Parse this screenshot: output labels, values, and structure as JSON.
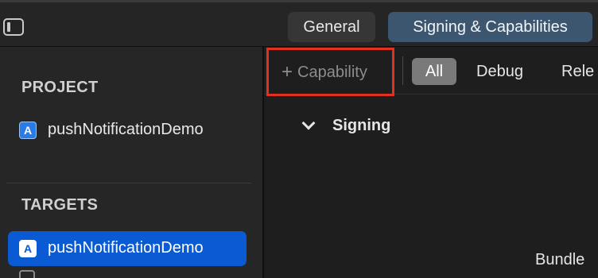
{
  "toolbar": {
    "tabs": [
      {
        "label": "General",
        "selected": false
      },
      {
        "label": "Signing & Capabilities",
        "selected": true
      }
    ]
  },
  "sidebar": {
    "project_header": "PROJECT",
    "project_item": "pushNotificationDemo",
    "targets_header": "TARGETS",
    "target_item": "pushNotificationDemo",
    "icon_glyph": "A"
  },
  "main": {
    "capability_plus": "+",
    "capability_label": "Capability",
    "filters": [
      {
        "label": "All",
        "selected": true
      },
      {
        "label": "Debug",
        "selected": false
      },
      {
        "label": "Rele",
        "selected": false
      }
    ],
    "signing_section": "Signing",
    "bundle_label": "Bundle"
  },
  "colors": {
    "selected_tab": "#3c566f",
    "selected_target": "#0a5bd3",
    "highlight": "#e2321f"
  }
}
